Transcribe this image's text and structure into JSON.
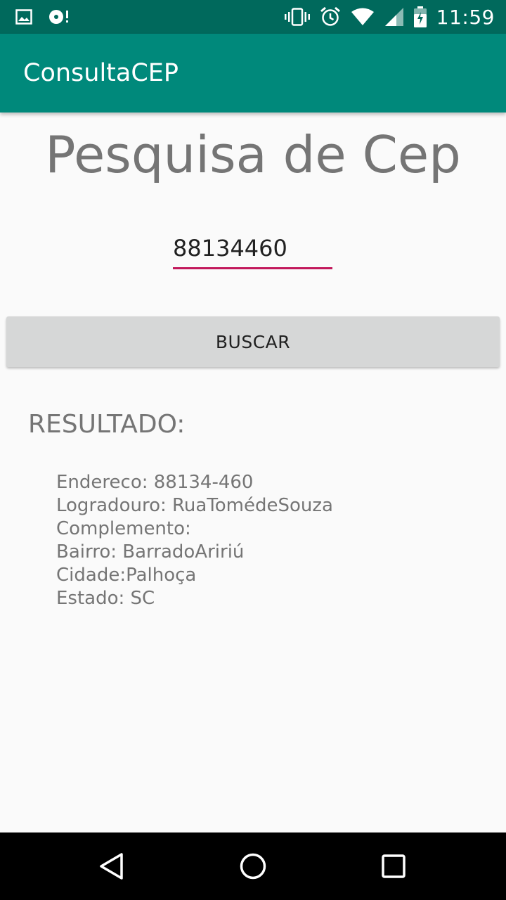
{
  "status_bar": {
    "time": "11:59",
    "left_icons": [
      "image-icon",
      "sync-disc-icon"
    ],
    "right_icons": [
      "vibrate-icon",
      "alarm-icon",
      "wifi-icon",
      "signal-icon",
      "battery-icon"
    ]
  },
  "app_bar": {
    "title": "ConsultaCEP"
  },
  "main": {
    "title": "Pesquisa de Cep",
    "cep_input": {
      "value": "88134460"
    },
    "search_button_label": "BUSCAR",
    "result_heading": "RESULTADO:",
    "result_lines": [
      "Endereco: 88134-460",
      "Logradouro: RuaTomédeSouza",
      "Complemento:",
      "Bairro: BarradoAririú",
      "Cidade:Palhoça",
      "Estado: SC"
    ]
  },
  "nav_bar": {
    "icons": [
      "back-icon",
      "home-icon",
      "recents-icon"
    ]
  },
  "colors": {
    "status_bar": "#00695c",
    "app_bar": "#00897b",
    "input_underline": "#c2185b",
    "button_bg": "#d6d7d7",
    "text_gray": "#757575"
  }
}
